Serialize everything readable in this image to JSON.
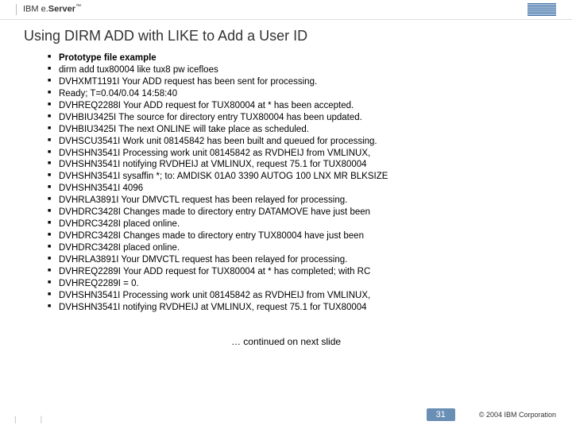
{
  "header": {
    "brand_prefix": "IBM e.",
    "brand_suffix": "Server",
    "trademark": "™"
  },
  "title": "Using DIRM ADD with LIKE to Add a User ID",
  "bullets": [
    "Prototype file example",
    "dirm add tux80004 like tux8 pw icefloes",
    "DVHXMT1191I Your ADD request has been sent for processing.",
    "Ready; T=0.04/0.04 14:58:40",
    "DVHREQ2288I Your ADD request for TUX80004 at * has been accepted.",
    "DVHBIU3425I The source for directory entry TUX80004 has been updated.",
    "DVHBIU3425I The next ONLINE will take place as scheduled.",
    "DVHSCU3541I Work unit 08145842 has been built and queued for processing.",
    "DVHSHN3541I Processing work unit 08145842 as RVDHEIJ from VMLINUX,",
    "DVHSHN3541I notifying RVDHEIJ at VMLINUX, request 75.1 for TUX80004",
    "DVHSHN3541I sysaffin *; to: AMDISK 01A0 3390 AUTOG 100 LNX MR BLKSIZE",
    "DVHSHN3541I 4096",
    "DVHRLA3891I Your DMVCTL request has been relayed for processing.",
    "DVHDRC3428I Changes made to directory entry DATAMOVE have just been",
    "DVHDRC3428I placed online.",
    "DVHDRC3428I Changes made to directory entry TUX80004 have just been",
    "DVHDRC3428I placed online.",
    "DVHRLA3891I Your DMVCTL request has been relayed for processing.",
    "DVHREQ2289I Your ADD request for TUX80004 at * has completed; with RC",
    "DVHREQ2289I = 0.",
    "DVHSHN3541I Processing work unit 08145842 as RVDHEIJ from VMLINUX,",
    "DVHSHN3541I notifying RVDHEIJ at VMLINUX, request 75.1 for TUX80004"
  ],
  "continued_text": "… continued on next slide",
  "footer": {
    "page_number": "31",
    "copyright": "© 2004 IBM Corporation"
  },
  "left_marks": [
    "|",
    "|"
  ]
}
